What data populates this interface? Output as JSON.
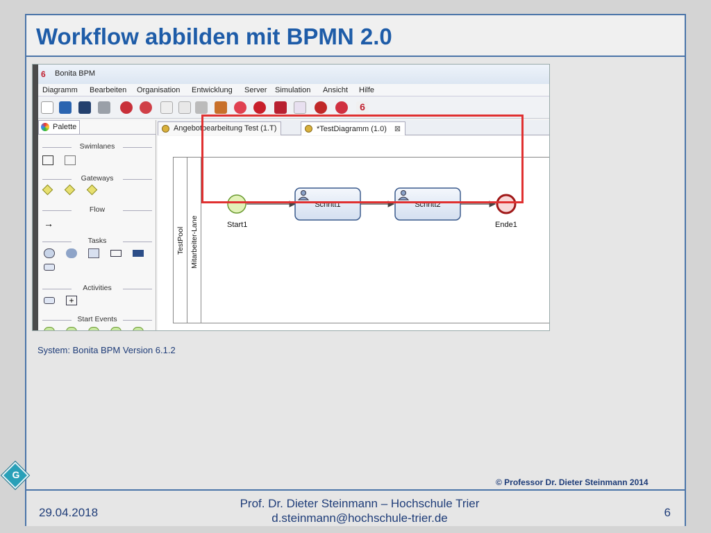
{
  "slide": {
    "title": "Workflow abbilden mit BPMN 2.0",
    "caption": "System: Bonita BPM Version 6.1.2",
    "copyright": "© Professor Dr. Dieter Steinmann 2014",
    "badge": "G",
    "footer": {
      "date": "29.04.2018",
      "author_line": "Prof. Dr. Dieter Steinmann – Hochschule Trier",
      "email": "d.steinmann@hochschule-trier.de",
      "page": "6"
    }
  },
  "app": {
    "logo": "6",
    "title": "Bonita BPM",
    "menu": [
      "Diagramm",
      "Bearbeiten",
      "Organisation",
      "Entwicklung",
      "Server",
      "Simulation",
      "Ansicht",
      "Hilfe"
    ],
    "palette": {
      "tab": "Palette",
      "sections": [
        "Swimlanes",
        "Gateways",
        "Flow",
        "Tasks",
        "Activities",
        "Start Events"
      ]
    },
    "tabs": [
      {
        "label": "Angebotbearbeitung Test (1.T)"
      },
      {
        "label": "*TestDiagramm (1.0)",
        "close": "⊠"
      }
    ],
    "diagram": {
      "pool": "TestPool",
      "lane": "Mitarbeiter-Lane",
      "start": "Start1",
      "task1": "Schritt1",
      "task2": "Schritt2",
      "end": "Ende1"
    }
  }
}
